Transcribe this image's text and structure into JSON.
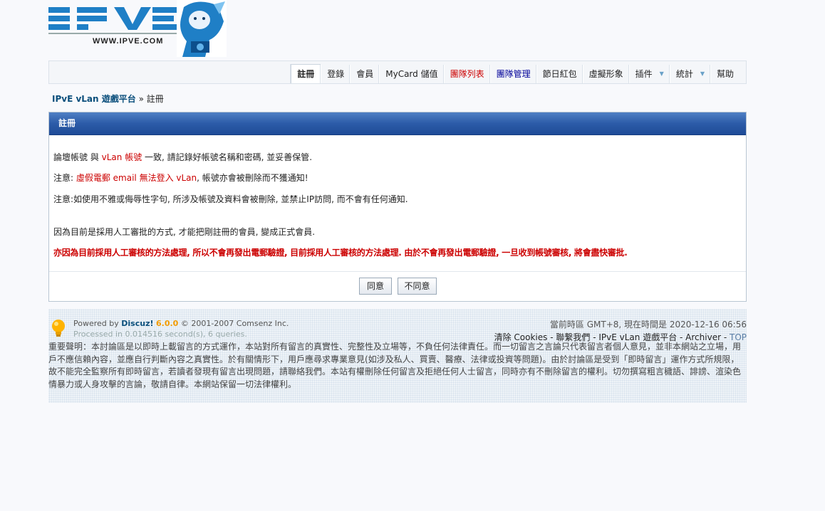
{
  "header": {
    "logo_text": "IPVE",
    "logo_url": "WWW.IPVE.COM"
  },
  "nav": {
    "items": [
      {
        "label": "註冊",
        "active": true
      },
      {
        "label": "登錄"
      },
      {
        "label": "會員"
      },
      {
        "label": "MyCard 儲值"
      },
      {
        "label": "團隊列表",
        "color": "#cc0000"
      },
      {
        "label": "團隊管理",
        "color": "#000099"
      },
      {
        "label": "節日紅包"
      },
      {
        "label": "虛擬形象"
      },
      {
        "label": "插件",
        "dropdown": true
      },
      {
        "label": "統計",
        "dropdown": true
      },
      {
        "label": "幫助"
      }
    ]
  },
  "breadcrumb": {
    "home": "IPvE vLan 遊戲平台",
    "sep": "»",
    "current": "註冊"
  },
  "box": {
    "title": "註冊",
    "line1_a": "論壇帳號 與 ",
    "line1_b": "vLan 帳號",
    "line1_c": " 一致, 請記錄好帳號名稱和密碼, 並妥善保管.",
    "line2_a": "注意: ",
    "line2_b": "虛假電郵 email 無法登入 vLan",
    "line2_c": ", 帳號亦會被刪除而不獲通知!",
    "line3": "注意:如使用不雅或侮辱性字句, 所涉及帳號及資料會被刪除, 並禁止IP訪問, 而不會有任何通知.",
    "line4": "因為目前是採用人工審批的方式, 才能把剛註冊的會員, 變成正式會員.",
    "line5": "亦因為目前採用人工審核的方法處理, 所以不會再發出電郵驗證, 目前採用人工審核的方法處理. 由於不會再發出電郵驗證, 一旦收到帳號審核, 將會盡快審批.",
    "agree": "同意",
    "disagree": "不同意"
  },
  "footer": {
    "powered_prefix": "Powered by ",
    "powered_name": "Discuz!",
    "powered_version": "6.0.0",
    "powered_suffix": " © 2001-2007 Comsenz Inc.",
    "processed": "Processed in 0.014516 second(s), 6 queries.",
    "time": "當前時區 GMT+8, 現在時間是 2020-12-16 06:56",
    "link_cookies": "清除 Cookies",
    "link_contact": "聯繫我們",
    "link_home": "IPvE vLan 遊戲平台",
    "link_archiver": "Archiver",
    "link_top": "TOP",
    "sep": " - ",
    "disclaimer": "重要聲明：本討論區是以即時上載留言的方式運作，本站對所有留言的真實性、完整性及立場等，不負任何法律責任。而一切留言之言論只代表留言者個人意見，並非本網站之立場，用戶不應信賴內容，並應自行判斷內容之真實性。於有關情形下，用戶應尋求專業意見(如涉及私人、買賣、醫療、法律或投資等問題)。由於討論區是受到「即時留言」運作方式所規限，故不能完全監察所有即時留言，若讀者發現有留言出現問題，請聯絡我們。本站有權刪除任何留言及拒絕任何人士留言，同時亦有不刪除留言的權利。切勿撰寫粗言穢語、誹謗、渲染色情暴力或人身攻擊的言論，敬請自律。本網站保留一切法律權利。"
  }
}
